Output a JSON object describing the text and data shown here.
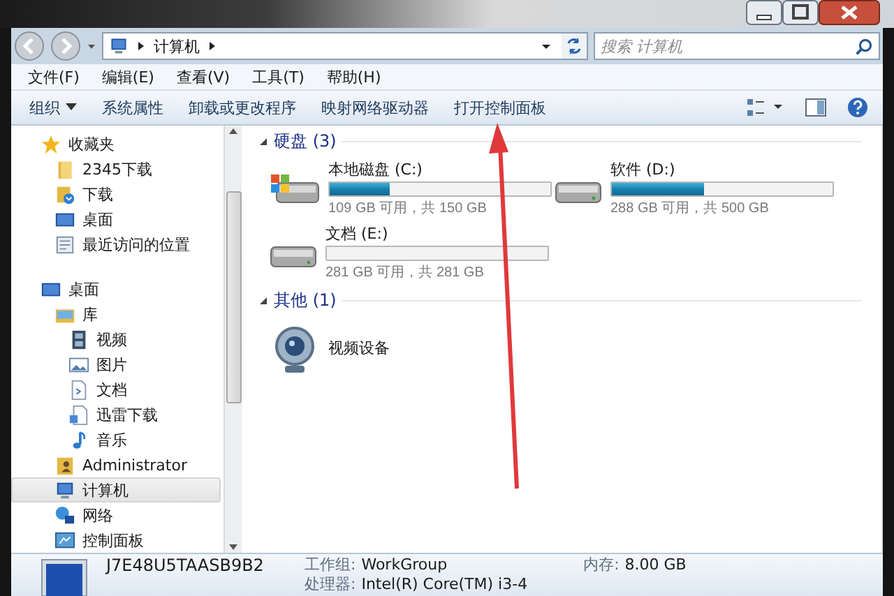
{
  "address_bar": {
    "path": [
      "计算机"
    ]
  },
  "search": {
    "placeholder": "搜索 计算机"
  },
  "menu": [
    "文件(F)",
    "编辑(E)",
    "查看(V)",
    "工具(T)",
    "帮助(H)"
  ],
  "toolbar": [
    {
      "label": "组织",
      "kind": "dropdown"
    },
    {
      "label": "系统属性",
      "kind": "button"
    },
    {
      "label": "卸载或更改程序",
      "kind": "button"
    },
    {
      "label": "映射网络驱动器",
      "kind": "button"
    },
    {
      "label": "打开控制面板",
      "kind": "button"
    }
  ],
  "sidebar": [
    {
      "label": "收藏夹",
      "kind": "star",
      "selected": false,
      "children": [
        {
          "label": "2345下载",
          "kind": "folder",
          "selected": false
        },
        {
          "label": "下载",
          "kind": "download",
          "selected": false
        },
        {
          "label": "桌面",
          "kind": "desktop",
          "selected": false
        },
        {
          "label": "最近访问的位置",
          "kind": "recent",
          "selected": false
        }
      ]
    },
    {
      "label": "桌面",
      "kind": "desktop",
      "selected": false,
      "children": [
        {
          "label": "库",
          "kind": "library",
          "selected": false,
          "children": [
            {
              "label": "视频",
              "kind": "video",
              "selected": false
            },
            {
              "label": "图片",
              "kind": "picture",
              "selected": false
            },
            {
              "label": "文档",
              "kind": "document",
              "selected": false
            },
            {
              "label": "迅雷下载",
              "kind": "thunder",
              "selected": false
            },
            {
              "label": "音乐",
              "kind": "music",
              "selected": false
            }
          ]
        },
        {
          "label": "Administrator",
          "kind": "user",
          "selected": false
        },
        {
          "label": "计算机",
          "kind": "computer",
          "selected": true
        },
        {
          "label": "网络",
          "kind": "network",
          "selected": false
        },
        {
          "label": "控制面板",
          "kind": "control",
          "selected": false
        }
      ]
    }
  ],
  "content": [
    {
      "title": "硬盘 (3)",
      "expanded": true,
      "items": [
        {
          "kind": "system-drive",
          "name": "本地磁盘 (C:)",
          "level": 0.27,
          "info": "109 GB 可用，共 150 GB"
        },
        {
          "kind": "drive",
          "name": "软件 (D:)",
          "level": 0.42,
          "info": "288 GB 可用，共 500 GB"
        },
        {
          "kind": "drive",
          "name": "文档 (E:)",
          "level": 0.0,
          "info": "281 GB 可用，共 281 GB"
        }
      ]
    },
    {
      "title": "其他 (1)",
      "expanded": true,
      "items": [
        {
          "kind": "webcam",
          "name": "视频设备"
        }
      ]
    }
  ],
  "details": {
    "name": "J7E48U5TAASB9B2",
    "fields": [
      {
        "label": "工作组:",
        "value": "WorkGroup"
      },
      {
        "label": "内存:",
        "value": "8.00 GB"
      },
      {
        "label": "处理器:",
        "value": "Intel(R) Core(TM) i3-4"
      }
    ]
  }
}
